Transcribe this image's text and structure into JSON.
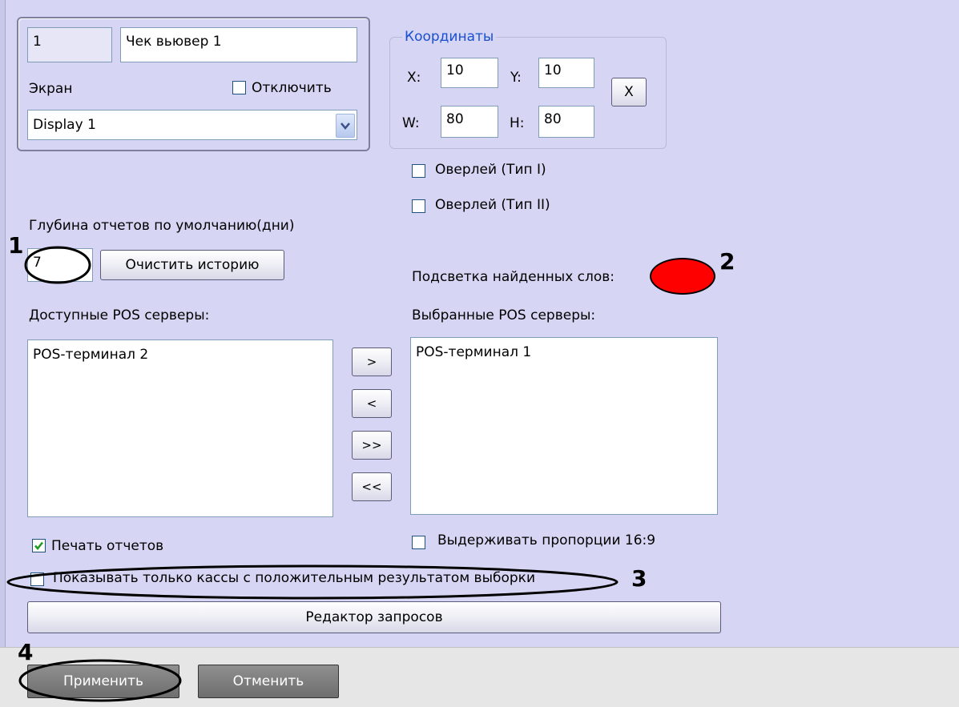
{
  "display": {
    "number": "1",
    "name": "Чек вьювер 1",
    "screen_label": "Экран",
    "disable_label": "Отключить",
    "screen_value": "Display 1"
  },
  "coords": {
    "title": "Координаты",
    "x_label": "X:",
    "x_value": "10",
    "y_label": "Y:",
    "y_value": "10",
    "w_label": "W:",
    "w_value": "80",
    "h_label": "H:",
    "h_value": "80",
    "reset_label": "X"
  },
  "overlay": {
    "type1_label": "Оверлей (Тип I)",
    "type2_label": "Оверлей (Тип II)"
  },
  "history": {
    "depth_label": "Глубина отчетов по умолчанию(дни)",
    "depth_value": "7",
    "clear_button": "Очистить историю"
  },
  "highlight": {
    "label": "Подсветка найденных слов:",
    "color": "#ff0000"
  },
  "servers": {
    "available_label": "Доступные POS серверы:",
    "selected_label": "Выбранные POS серверы:",
    "available": [
      "POS-терминал 2"
    ],
    "selected": [
      "POS-терминал 1"
    ],
    "move_right": ">",
    "move_left": "<",
    "move_all_right": ">>",
    "move_all_left": "<<"
  },
  "options": {
    "print_reports": "Печать отчетов",
    "print_reports_checked": true,
    "keep_ratio": "Выдерживать пропорции 16:9",
    "show_positive": "Показывать только кассы с положительным результатом выборки",
    "query_editor": "Редактор запросов"
  },
  "footer": {
    "apply": "Применить",
    "cancel": "Отменить"
  },
  "markers": [
    "1",
    "2",
    "3",
    "4"
  ]
}
